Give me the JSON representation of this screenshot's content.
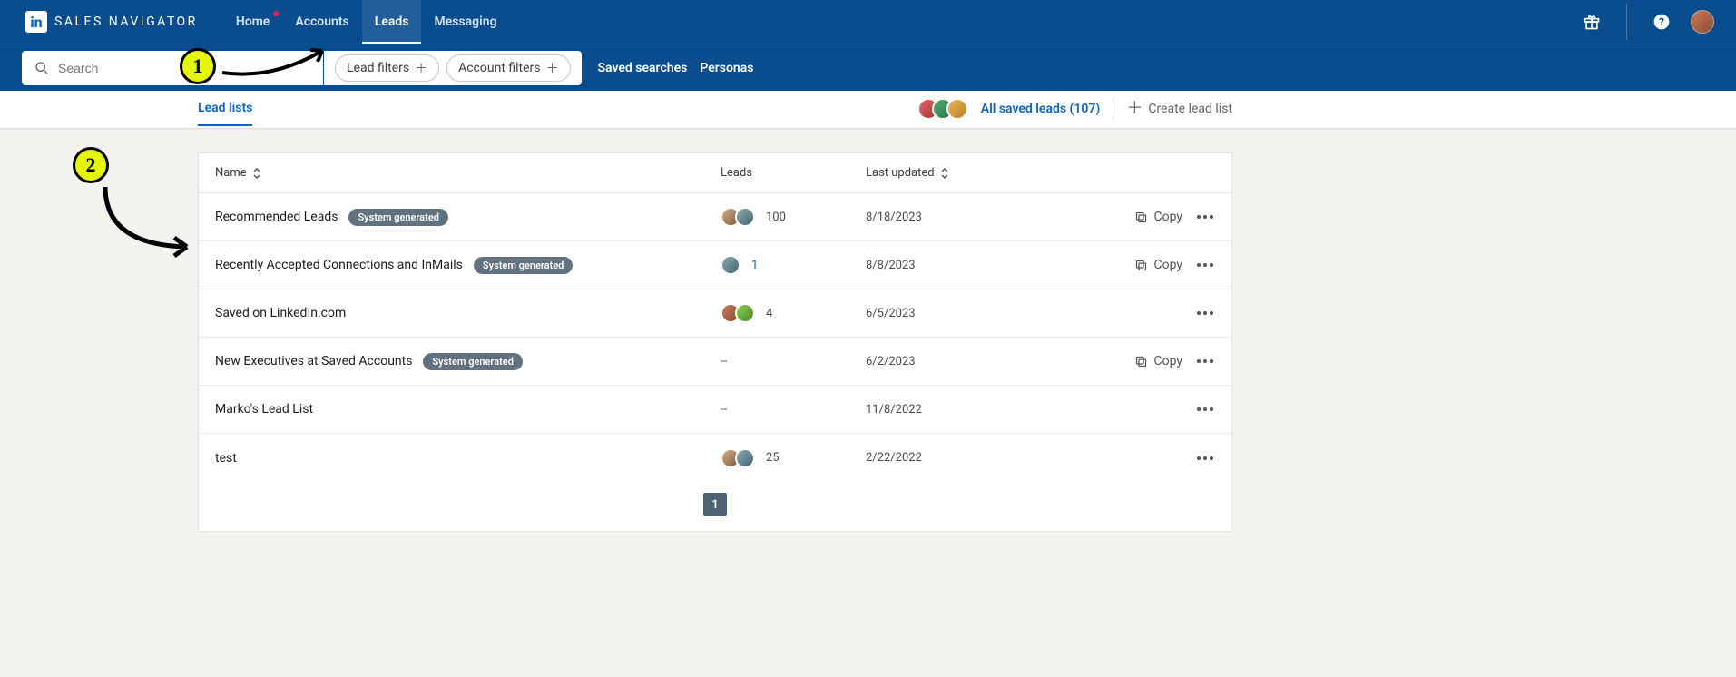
{
  "brand": "SALES NAVIGATOR",
  "logoText": "in",
  "nav": {
    "home": "Home",
    "accounts": "Accounts",
    "leads": "Leads",
    "messaging": "Messaging"
  },
  "search": {
    "placeholder": "Search"
  },
  "filters": {
    "lead": "Lead filters",
    "account": "Account filters",
    "saved": "Saved searches",
    "personas": "Personas"
  },
  "subtabs": {
    "leadlists": "Lead lists",
    "allsaved": "All saved leads (107)",
    "create": "Create lead list"
  },
  "table": {
    "headers": {
      "name": "Name",
      "leads": "Leads",
      "updated": "Last updated"
    },
    "badge": "System generated",
    "copy": "Copy",
    "rows": [
      {
        "name": "Recommended Leads",
        "badge": true,
        "leads": "100",
        "leadsLink": false,
        "avatars": 2,
        "dash": false,
        "date": "8/18/2023",
        "copy": true
      },
      {
        "name": "Recently Accepted Connections and InMails",
        "badge": true,
        "leads": "1",
        "leadsLink": true,
        "avatars": 1,
        "dash": false,
        "date": "8/8/2023",
        "copy": true
      },
      {
        "name": "Saved on LinkedIn.com",
        "badge": false,
        "leads": "4",
        "leadsLink": false,
        "avatars": 2,
        "dash": false,
        "date": "6/5/2023",
        "copy": false
      },
      {
        "name": "New Executives at Saved Accounts",
        "badge": true,
        "leads": "--",
        "leadsLink": false,
        "avatars": 0,
        "dash": true,
        "date": "6/2/2023",
        "copy": true
      },
      {
        "name": "Marko's Lead List",
        "badge": false,
        "leads": "--",
        "leadsLink": false,
        "avatars": 0,
        "dash": true,
        "date": "11/8/2022",
        "copy": false
      },
      {
        "name": "test",
        "badge": false,
        "leads": "25",
        "leadsLink": false,
        "avatars": 2,
        "dash": false,
        "date": "2/22/2022",
        "copy": false
      }
    ]
  },
  "pager": {
    "current": "1"
  },
  "annotations": {
    "one": "1",
    "two": "2"
  }
}
